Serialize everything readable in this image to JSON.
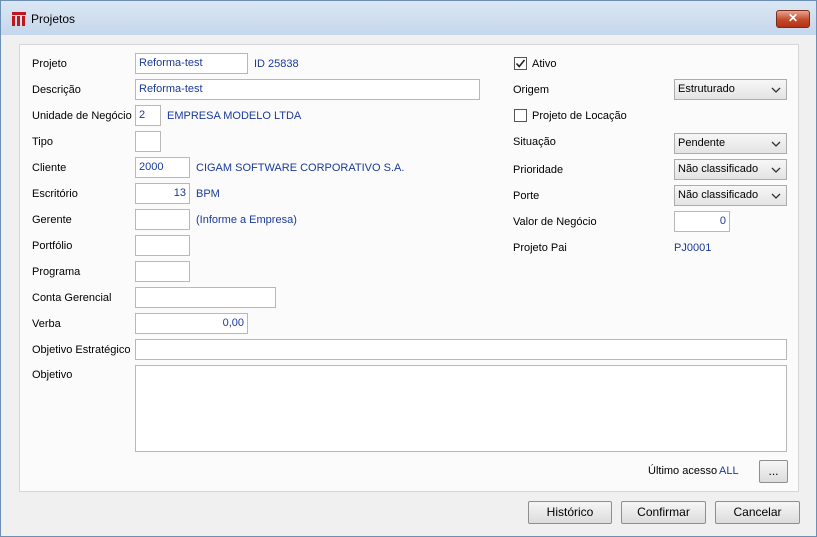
{
  "window": {
    "title": "Projetos",
    "close_glyph": "✕"
  },
  "left": {
    "projeto": {
      "label": "Projeto",
      "value": "Reforma-test",
      "id_text": "ID 25838"
    },
    "descricao": {
      "label": "Descrição",
      "value": "Reforma-test"
    },
    "unidade": {
      "label": "Unidade de Negócio",
      "value": "2",
      "name": "EMPRESA MODELO LTDA"
    },
    "tipo": {
      "label": "Tipo",
      "value": ""
    },
    "cliente": {
      "label": "Cliente",
      "value": "2000",
      "name": "CIGAM SOFTWARE CORPORATIVO S.A."
    },
    "escritorio": {
      "label": "Escritório",
      "value": "13",
      "name": "BPM"
    },
    "gerente": {
      "label": "Gerente",
      "value": "",
      "hint": "(Informe a Empresa)"
    },
    "portfolio": {
      "label": "Portfólio",
      "value": ""
    },
    "programa": {
      "label": "Programa",
      "value": ""
    },
    "conta_gerencial": {
      "label": "Conta Gerencial",
      "value": ""
    },
    "verba": {
      "label": "Verba",
      "value": "0,00"
    },
    "objetivo_estrategico": {
      "label": "Objetivo Estratégico",
      "value": ""
    },
    "objetivo": {
      "label": "Objetivo",
      "value": ""
    }
  },
  "right": {
    "ativo": {
      "label": "Ativo",
      "checked": true
    },
    "origem": {
      "label": "Origem",
      "value": "Estruturado"
    },
    "locacao": {
      "label": "Projeto de Locação",
      "checked": false
    },
    "situacao": {
      "label": "Situação",
      "value": "Pendente"
    },
    "prioridade": {
      "label": "Prioridade",
      "value": "Não classificado"
    },
    "porte": {
      "label": "Porte",
      "value": "Não classificado"
    },
    "valor_negocio": {
      "label": "Valor de Negócio",
      "value": "0"
    },
    "projeto_pai": {
      "label": "Projeto Pai",
      "value": "PJ0001"
    }
  },
  "footer": {
    "ultimo_acesso_label": "Último acesso",
    "ultimo_acesso_value": "ALL",
    "ellipsis_label": "...",
    "historico": "Histórico",
    "confirmar": "Confirmar",
    "cancelar": "Cancelar"
  },
  "colors": {
    "value_text": "#1b3a9a",
    "brand_icon": "#c0171c"
  },
  "icons": {
    "app": "app-logo-icon",
    "close": "close-icon",
    "dropdown": "chevron-down-icon",
    "check": "check-icon"
  }
}
